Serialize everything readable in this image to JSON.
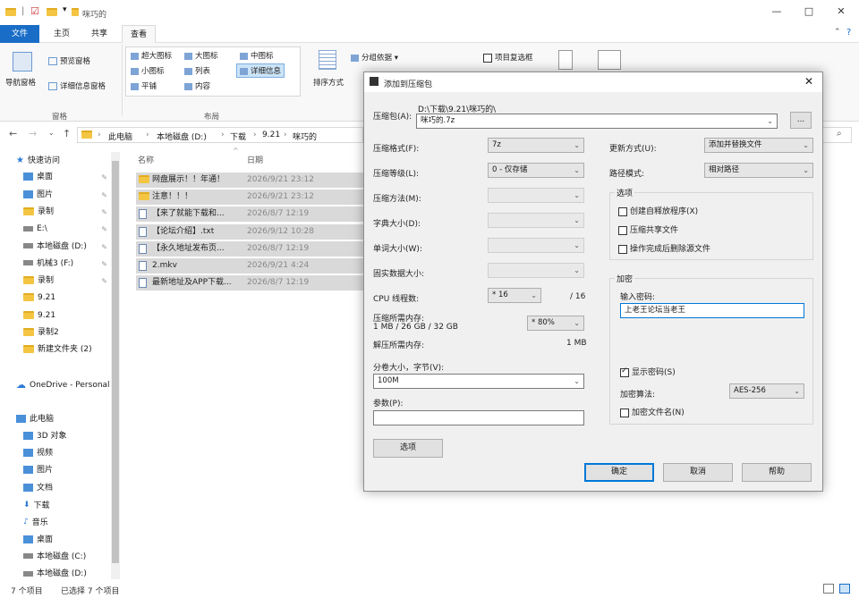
{
  "window": {
    "title": "咪巧的"
  },
  "ribbon": {
    "tabs": [
      "文件",
      "主页",
      "共享",
      "查看"
    ],
    "pane_group": {
      "nav_pane": "导航窗格",
      "preview_pane": "预览窗格",
      "details_pane": "详细信息窗格",
      "label": "窗格"
    },
    "layout_group": {
      "items": [
        "超大图标",
        "大图标",
        "中图标",
        "小图标",
        "列表",
        "详细信息",
        "平铺",
        "内容"
      ],
      "label": "布局"
    },
    "sort_label": "排序方式",
    "group_by": "分组依据",
    "item_checkbox": "项目复选框"
  },
  "address": {
    "path": [
      "此电脑",
      "本地磁盘 (D:)",
      "下载",
      "9.21",
      "咪巧的"
    ]
  },
  "nav": {
    "items": [
      {
        "label": "快速访问",
        "icon": "star-icon",
        "pin": false
      },
      {
        "label": "桌面",
        "icon": "desktop-icon",
        "pin": true
      },
      {
        "label": "图片",
        "icon": "pictures-icon",
        "pin": true
      },
      {
        "label": "录制",
        "icon": "folder-icon",
        "pin": true
      },
      {
        "label": "E:\\",
        "icon": "drive-icon",
        "pin": true
      },
      {
        "label": "本地磁盘 (D:)",
        "icon": "drive-icon",
        "pin": true
      },
      {
        "label": "机械3 (F:)",
        "icon": "drive-icon",
        "pin": true
      },
      {
        "label": "录制",
        "icon": "folder-icon",
        "pin": true
      },
      {
        "label": "9.21",
        "icon": "folder-icon",
        "pin": false
      },
      {
        "label": "9.21",
        "icon": "folder-icon",
        "pin": false
      },
      {
        "label": "录制2",
        "icon": "folder-icon",
        "pin": false
      },
      {
        "label": "新建文件夹 (2)",
        "icon": "folder-icon",
        "pin": false
      },
      {
        "label": "",
        "icon": "",
        "pin": false
      },
      {
        "label": "OneDrive - Personal",
        "icon": "cloud-icon",
        "pin": false
      },
      {
        "label": "",
        "icon": "",
        "pin": false
      },
      {
        "label": "此电脑",
        "icon": "computer-icon",
        "pin": false
      },
      {
        "label": "3D 对象",
        "icon": "cube-icon",
        "pin": false
      },
      {
        "label": "视频",
        "icon": "video-icon",
        "pin": false
      },
      {
        "label": "图片",
        "icon": "pictures-icon",
        "pin": false
      },
      {
        "label": "文档",
        "icon": "document-icon",
        "pin": false
      },
      {
        "label": "下载",
        "icon": "download-icon",
        "pin": false
      },
      {
        "label": "音乐",
        "icon": "music-icon",
        "pin": false
      },
      {
        "label": "桌面",
        "icon": "desktop-icon",
        "pin": false
      },
      {
        "label": "本地磁盘 (C:)",
        "icon": "drive-icon",
        "pin": false
      },
      {
        "label": "本地磁盘 (D:)",
        "icon": "drive-icon",
        "pin": false
      }
    ]
  },
  "files": {
    "col_name": "名称",
    "col_date": "日期",
    "rows": [
      {
        "name": "网盘展示！！年通！",
        "date": "2026/9/21 23:12",
        "icon": "folder-icon"
      },
      {
        "name": "注意！！！",
        "date": "2026/9/21 23:12",
        "icon": "folder-icon"
      },
      {
        "name": "【来了就能下载和...",
        "date": "2026/8/7 12:19",
        "icon": "document-icon"
      },
      {
        "name": "【论坛介绍】.txt",
        "date": "2026/9/12 10:28",
        "icon": "document-icon"
      },
      {
        "name": "【永久地址发布页...",
        "date": "2026/8/7 12:19",
        "icon": "document-icon"
      },
      {
        "name": "2.mkv",
        "date": "2026/9/21 4:24",
        "icon": "video-icon"
      },
      {
        "name": "最新地址及APP下载...",
        "date": "2026/8/7 12:19",
        "icon": "document-icon"
      }
    ]
  },
  "status": {
    "count": "7 个项目",
    "selected": "已选择 7 个项目"
  },
  "dialog": {
    "title": "添加到压缩包",
    "archive_label": "压缩包(A):",
    "archive_dir": "D:\\下载\\9.21\\咪巧的\\",
    "archive_name": "咪巧的.7z",
    "browse": "...",
    "format_label": "压缩格式(F):",
    "format_value": "7z",
    "level_label": "压缩等级(L):",
    "level_value": "0 - 仅存储",
    "method_label": "压缩方法(M):",
    "dict_label": "字典大小(D):",
    "word_label": "单词大小(W):",
    "solid_label": "固实数据大小:",
    "cpu_label": "CPU 线程数:",
    "cpu_value": "* 16",
    "cpu_max": "/ 16",
    "mem_label": "压缩所需内存:",
    "mem_detail": "1 MB / 26 GB / 32 GB",
    "mem_pct": "* 80%",
    "decomp_label": "解压所需内存:",
    "decomp_value": "1 MB",
    "split_label": "分卷大小，字节(V):",
    "split_value": "100M",
    "params_label": "参数(P):",
    "options_button": "选项",
    "update_label": "更新方式(U):",
    "update_value": "添加并替换文件",
    "path_label": "路径模式:",
    "path_value": "相对路径",
    "options_group": "选项",
    "opt_sfx": "创建自释放程序(X)",
    "opt_shared": "压缩共享文件",
    "opt_delete": "操作完成后删除源文件",
    "encrypt_group": "加密",
    "password_label": "输入密码:",
    "password_value": "上老王论坛当老王",
    "show_password": "显示密码(S)",
    "enc_method_label": "加密算法:",
    "enc_method_value": "AES-256",
    "encrypt_names": "加密文件名(N)",
    "ok": "确定",
    "cancel": "取消",
    "help": "帮助"
  }
}
